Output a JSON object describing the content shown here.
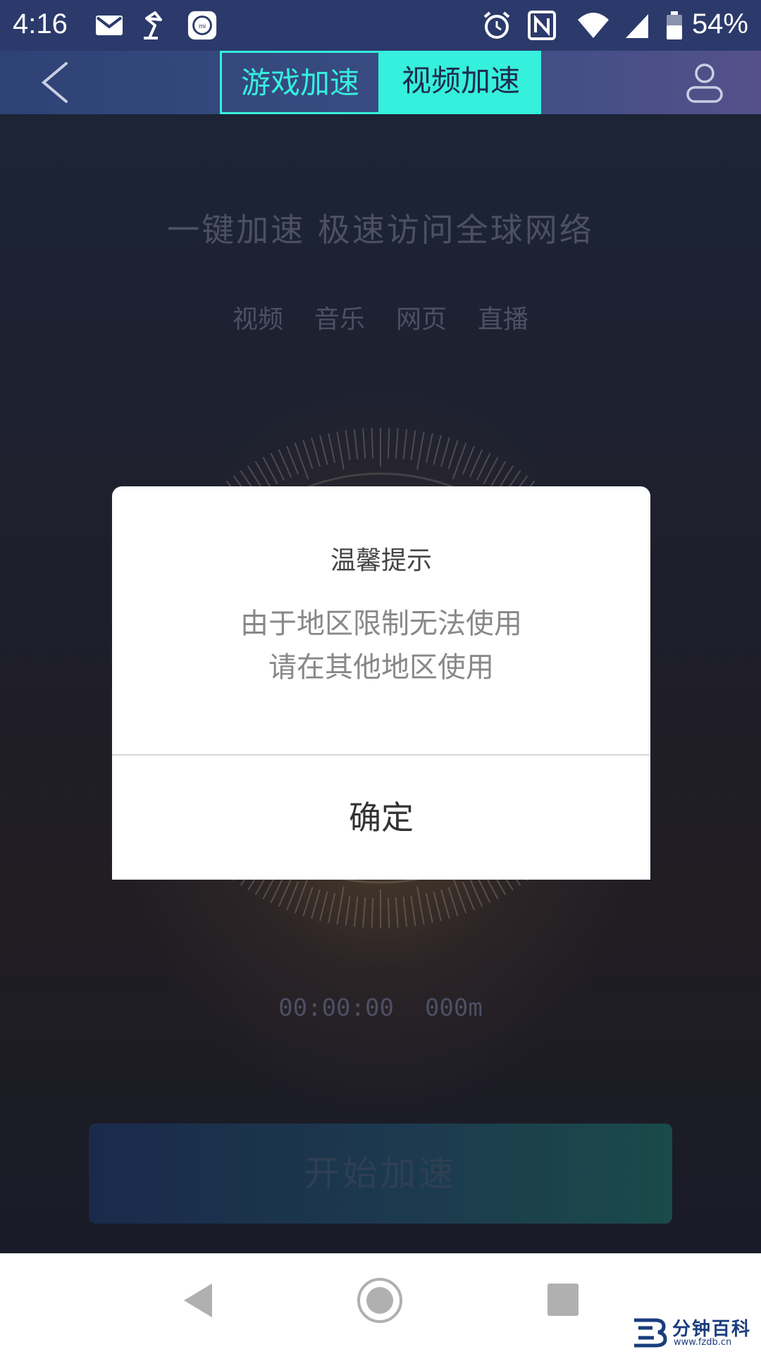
{
  "status_bar": {
    "time": "4:16",
    "battery_percent": "54%",
    "icons": [
      "mail-icon",
      "lamp-icon",
      "mi-icon",
      "alarm-icon",
      "nfc-icon",
      "wifi-icon",
      "signal-icon",
      "battery-icon"
    ]
  },
  "header": {
    "tabs": [
      {
        "label": "游戏加速",
        "active": false
      },
      {
        "label": "视频加速",
        "active": true
      }
    ]
  },
  "main": {
    "slogan": "一键加速 极速访问全球网络",
    "categories": [
      "视频",
      "音乐",
      "网页",
      "直播"
    ],
    "timer": "00:00:00",
    "distance": "000m",
    "start_button": "开始加速"
  },
  "dialog": {
    "title": "温馨提示",
    "message_line1": "由于地区限制无法使用",
    "message_line2": "请在其他地区使用",
    "confirm": "确定"
  },
  "watermark": {
    "text": "分钟百科",
    "url": "www.fzdb.cn"
  },
  "colors": {
    "accent": "#35f0dc",
    "header": "#2e4276"
  }
}
